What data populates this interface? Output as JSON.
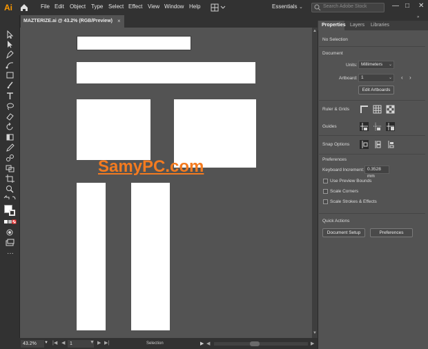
{
  "app": {
    "logo": "Ai"
  },
  "menu": [
    "File",
    "Edit",
    "Object",
    "Type",
    "Select",
    "Effect",
    "View",
    "Window",
    "Help"
  ],
  "workspace": {
    "label": "Essentials"
  },
  "search": {
    "placeholder": "Search Adobe Stock"
  },
  "window_controls": {
    "minimize": "—",
    "maximize": "□",
    "close": "✕"
  },
  "document_tab": {
    "title": "MAZTERIZE.ai @ 43.2% (RGB/Preview)",
    "close": "×"
  },
  "watermark": "SamyPC.com",
  "status": {
    "zoom": "43.2%",
    "artboard_number": "1",
    "tool": "Selection",
    "nav_first": "|◀",
    "nav_prev": "◀",
    "nav_next": "▶",
    "nav_last": "▶|"
  },
  "panel": {
    "tabs": [
      "Properties",
      "Layers",
      "Libraries"
    ],
    "no_selection": "No Selection",
    "document_heading": "Document",
    "units_label": "Units:",
    "units_value": "Millimeters",
    "artboard_label": "Artboard:",
    "artboard_value": "1",
    "edit_artboards": "Edit Artboards",
    "rulers_grids": "Ruler & Grids",
    "guides": "Guides",
    "snap_options": "Snap Options",
    "preferences_heading": "Preferences",
    "keyboard_increment_label": "Keyboard Increment:",
    "keyboard_increment_value": "0.3528 mm",
    "use_preview_bounds": "Use Preview Bounds",
    "scale_corners": "Scale Corners",
    "scale_strokes": "Scale Strokes & Effects",
    "quick_actions": "Quick Actions",
    "document_setup": "Document Setup",
    "preferences_button": "Preferences"
  },
  "colors": {
    "accent_logo": "#ff9a00",
    "watermark": "#f47b20",
    "ui_dark": "#323232",
    "canvas": "#535353"
  }
}
